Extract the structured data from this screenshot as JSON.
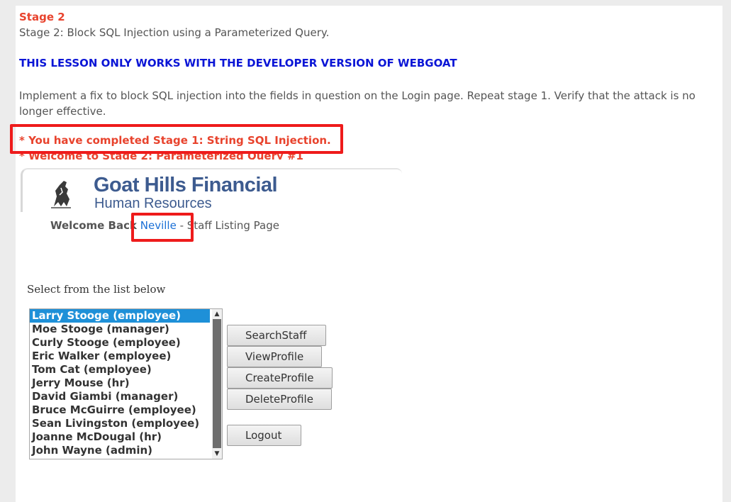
{
  "stage": {
    "heading": "Stage 2",
    "subtitle": "Stage 2: Block SQL Injection using a Parameterized Query.",
    "warning": "THIS LESSON ONLY WORKS WITH THE DEVELOPER VERSION OF WEBGOAT",
    "instructions": "Implement a fix to block SQL injection into the fields in question on the Login page. Repeat stage 1. Verify that the attack is no longer effective.",
    "completed_msg": "* You have completed Stage 1: String SQL Injection.",
    "welcome_msg": "* Welcome to Stage 2: Parameterized Query #1"
  },
  "banner": {
    "brand_title": "Goat Hills Financial",
    "brand_subtitle": "Human Resources"
  },
  "welcome": {
    "prefix": "Welcome Back",
    "user": "Neville",
    "suffix": " - Staff Listing Page"
  },
  "staff": {
    "label": "Select from the list below",
    "items": [
      "Larry Stooge (employee)",
      "Moe Stooge (manager)",
      "Curly Stooge (employee)",
      "Eric Walker (employee)",
      "Tom Cat (employee)",
      "Jerry Mouse (hr)",
      "David Giambi (manager)",
      "Bruce McGuirre (employee)",
      "Sean Livingston (employee)",
      "Joanne McDougal (hr)",
      "John Wayne (admin)"
    ],
    "selected_index": 0
  },
  "buttons": {
    "search": "SearchStaff",
    "view": "ViewProfile",
    "create": "CreateProfile",
    "delete": "DeleteProfile",
    "logout": "Logout"
  },
  "colors": {
    "highlight": "#ee1b1b",
    "accent_red": "#e8432d",
    "warning_blue": "#0a15d6",
    "link_blue": "#1a6fd6",
    "selection": "#1e90d8"
  }
}
